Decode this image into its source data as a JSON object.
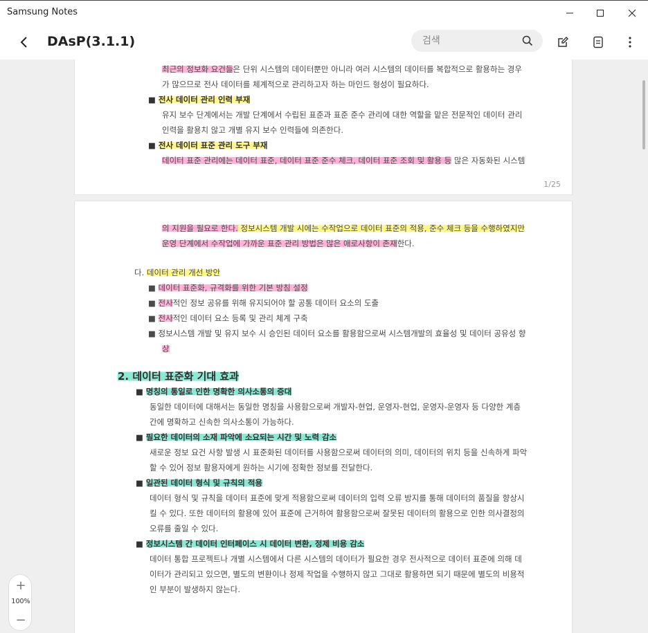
{
  "window": {
    "app_title": "Samsung Notes"
  },
  "toolbar": {
    "note_title": "DAsP(3.1.1)",
    "search_placeholder": "검색"
  },
  "page1": {
    "lines": [
      {
        "pre": "",
        "hl": "최근의 정보화 요건들",
        "post": "은 단위 시스템의 데이터뿐만 아니라 여러 시스템의 데이터를 복합적으로 활용하는 경우"
      },
      {
        "pre": "",
        "hl": "",
        "post": "가 많으므로 전사 데이터를 체계적으로 관리하고자 하는 마인드 형성이 필요하다."
      },
      {
        "pre": "■ ",
        "hl": "전사 데이터 관리 인력 부재",
        "post": ""
      },
      {
        "pre": "",
        "hl": "",
        "post": "유지 보수 단계에서는 개발 단계에서 수립된 표준과 표준 준수 관리에 대한 역할을 맡은 전문적인 데이터 관리"
      },
      {
        "pre": "",
        "hl": "",
        "post": "인력을 활용치 않고 개별 유지 보수 인력들에 의존한다."
      },
      {
        "pre": "■ ",
        "hl": "전사 데이터 표준 관리 도구 부재",
        "post": ""
      },
      {
        "pre": "",
        "hl": "데이터 표준 관리에는 데이터 표준, 데이터 표준 준수 체크, 데이터 표준 조회 및 활용 등",
        "post": " 많은 자동화된 시스템"
      }
    ],
    "page_number": "1/25"
  },
  "page2": {
    "lines": [
      {
        "pre": "",
        "hl": "의 지원을 필요로 한다.",
        "post": " 정보시스템 개발 시에는 수작업으로 데이터 표준의 적용, 준수 체크 등을 수행하였지만"
      },
      {
        "pre": "",
        "hl": "운영 단계에서 수작업에 가까운 표준 관리 방법은 많은 애로사항이 존재",
        "post": "한다."
      },
      {
        "pre": "다. ",
        "hl": "데이터 관리 개선 방안",
        "post": ""
      },
      {
        "pre": "■ ",
        "hl": "데이터 표준화, 규격화를 위한 기본 방침 설정",
        "post": ""
      },
      {
        "pre": "■ ",
        "hl": "전사",
        "post": "적인 정보 공유를 위해 유지되어야 할 공통 데이터 요소의 도출"
      },
      {
        "pre": "■ ",
        "hl": "전사",
        "post": "적인 데이터 요소 등록 및 관리 체계 구축"
      },
      {
        "pre": "■ ",
        "hl": "",
        "post": "정보시스템 개발 및 유지 보수 시 승인된 데이터 요소를 활용함으로써 시스템개발의 효율성 및 데이터 공유성 향"
      },
      {
        "pre": "",
        "hl": "상",
        "post": ""
      },
      {
        "pre": "",
        "hl": "2. 데이터 표준화 기대 효과",
        "post": ""
      },
      {
        "pre": "■ ",
        "hl": "명칭의 통일로 인한 명확한 의사소통의 증대",
        "post": ""
      },
      {
        "pre": "",
        "hl": "",
        "post": "동일한 데이터에 대해서는 동일한 명칭을 사용함으로써 개발자-현업, 운영자-현업, 운영자-운영자 등 다양한 계층"
      },
      {
        "pre": "",
        "hl": "",
        "post": "간에 명확하고 신속한 의사소통이 가능하다."
      },
      {
        "pre": "■ ",
        "hl": "필요한 데이터의 소재 파악에 소요되는 시간 및 노력 감소",
        "post": ""
      },
      {
        "pre": "",
        "hl": "",
        "post": "새로운 정보 요건 사항 발생 시 표준화된 데이터를 사용함으로써 데이터의 의미, 데이터의 위치 등을 신속하게 파악"
      },
      {
        "pre": "",
        "hl": "",
        "post": "할 수 있어 정보 활용자에게 원하는 시기에 정확한 정보를 전달한다."
      },
      {
        "pre": "■ ",
        "hl": "일관된 데이터 형식 및 규칙의 적용",
        "post": ""
      },
      {
        "pre": "",
        "hl": "",
        "post": "데이터 형식 및 규칙을 데이터 표준에 맞게 적용함으로써 데이터의 입력 오류 방지를 통해 데이터의 품질을 향상시"
      },
      {
        "pre": "",
        "hl": "",
        "post": "킬 수 있다. 또한 데이터의 활용에 있어 표준에 근거하여 활용함으로써 잘못된 데이터의 활용으로 인한 의사결정의"
      },
      {
        "pre": "",
        "hl": "",
        "post": "오류를 줄일 수 있다."
      },
      {
        "pre": "■ ",
        "hl": "정보시스템 간 데이터 인터페이스 시 데이터 변환, 정제 비용 감소",
        "post": ""
      },
      {
        "pre": "",
        "hl": "",
        "post": "데이터 통합 프로젝트나 개별 시스템에서 다른 시스템의 데이터가 필요한 경우 전사적으로 데이터 표준에 의해 데"
      },
      {
        "pre": "",
        "hl": "",
        "post": "이터가 관리되고 있으면, 별도의 변환이나 정제 작업을 수행하지 않고 그대로 활용하면 되기 때문에 별도의 비용적"
      },
      {
        "pre": "",
        "hl": "",
        "post": "인 부분이 발생하지 않는다."
      }
    ]
  },
  "zoom": {
    "level": "100%",
    "plus": "+",
    "minus": "−"
  },
  "colors": {
    "pink_highlight": "#ff8ac4",
    "yellow_highlight": "#fff678",
    "green_highlight": "#66e2c4"
  }
}
